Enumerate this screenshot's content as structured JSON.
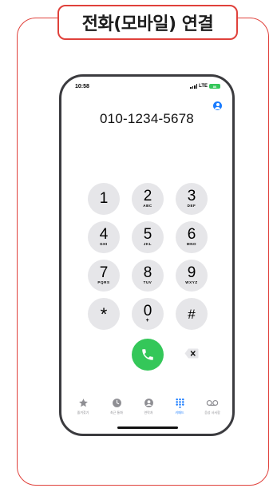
{
  "banner": {
    "title": "전화(모바일) 연결"
  },
  "status_bar": {
    "time": "10:58",
    "network": "LTE",
    "battery_level": "86"
  },
  "dialer": {
    "number": "010-1234-5678",
    "keys": [
      {
        "digit": "1",
        "letters": ""
      },
      {
        "digit": "2",
        "letters": "ABC"
      },
      {
        "digit": "3",
        "letters": "DEF"
      },
      {
        "digit": "4",
        "letters": "GHI"
      },
      {
        "digit": "5",
        "letters": "JKL"
      },
      {
        "digit": "6",
        "letters": "MNO"
      },
      {
        "digit": "7",
        "letters": "PQRS"
      },
      {
        "digit": "8",
        "letters": "TUV"
      },
      {
        "digit": "9",
        "letters": "WXYZ"
      },
      {
        "digit": "*",
        "letters": ""
      },
      {
        "digit": "0",
        "letters": "+"
      },
      {
        "digit": "#",
        "letters": ""
      }
    ]
  },
  "tabs": [
    {
      "label": "즐겨찾기",
      "icon": "star-icon"
    },
    {
      "label": "최근 통화",
      "icon": "clock-icon"
    },
    {
      "label": "연락처",
      "icon": "contacts-icon"
    },
    {
      "label": "키패드",
      "icon": "keypad-icon",
      "active": true
    },
    {
      "label": "음성 사서함",
      "icon": "voicemail-icon"
    }
  ],
  "colors": {
    "accent": "#1a7cff",
    "call": "#34c759",
    "frame": "#e0413b"
  }
}
